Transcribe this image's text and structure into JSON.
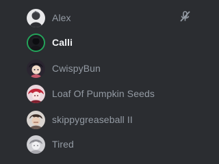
{
  "voice_channel": {
    "users": [
      {
        "name": "Alex",
        "avatar": "avatar-alex",
        "status_icon": "mic-muted-icon"
      },
      {
        "name": "Calli",
        "avatar": "avatar-calli",
        "speaking": true
      },
      {
        "name": "CwispyBun",
        "avatar": "avatar-cwispybun"
      },
      {
        "name": "Loaf Of Pumpkin Seeds",
        "avatar": "avatar-loaf"
      },
      {
        "name": "skippygreaseball II",
        "avatar": "avatar-skippy"
      },
      {
        "name": "Tired",
        "avatar": "avatar-tired"
      }
    ]
  },
  "colors": {
    "background": "#2b2d31",
    "username_muted": "#949ba4",
    "username_active": "#f2f3f5",
    "speaking_ring": "#23a55a",
    "icon": "#949ba4"
  }
}
